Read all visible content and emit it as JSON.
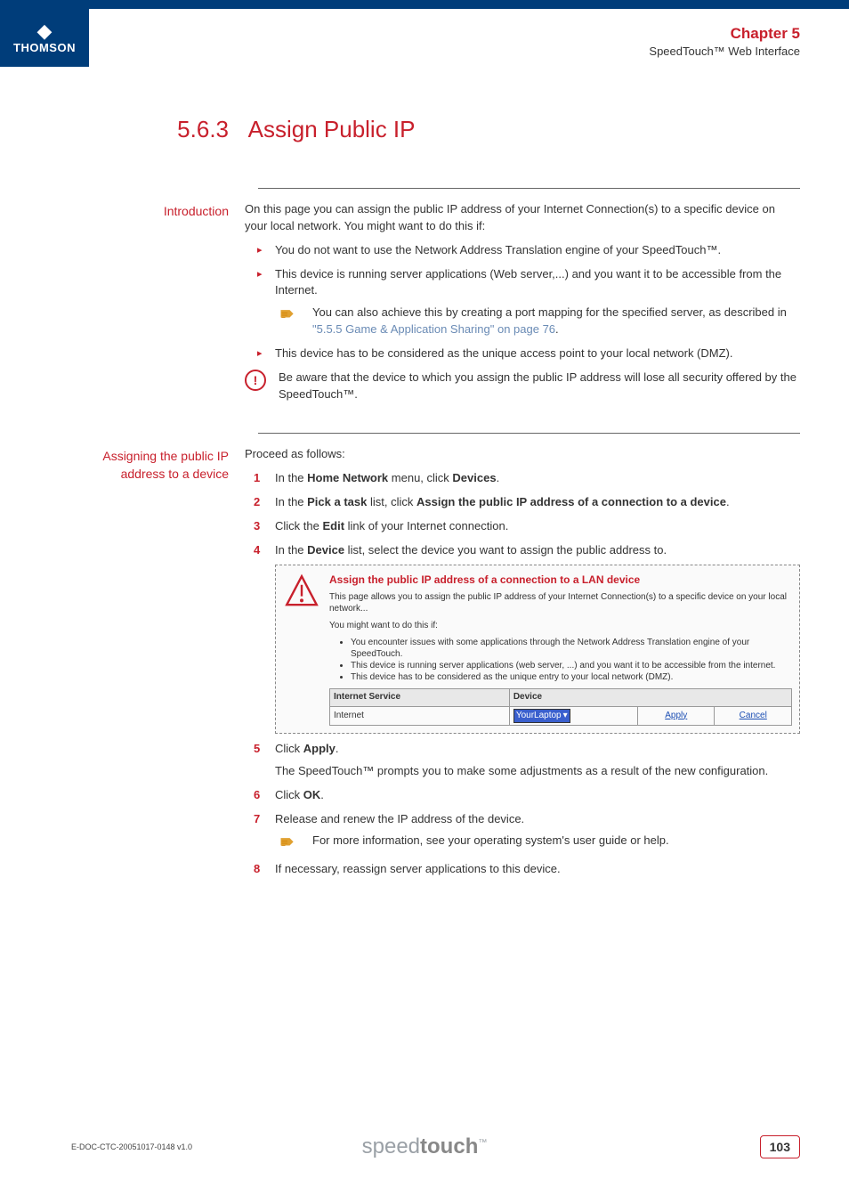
{
  "header": {
    "logo_text": "THOMSON",
    "chapter": "Chapter 5",
    "subtitle": "SpeedTouch™ Web Interface"
  },
  "section": {
    "number": "5.6.3",
    "title": "Assign Public IP"
  },
  "intro": {
    "label": "Introduction",
    "lead": "On this page you can assign the public IP address of your Internet Connection(s) to a specific device on your local network. You might want to do this if:",
    "bullets": {
      "b1": "You do not want to use the Network Address Translation engine of your SpeedTouch™.",
      "b2": "This device is running server applications (Web server,...) and you want it to be accessible from the Internet.",
      "b3": "This device has to be considered as the unique access point to your local network (DMZ)."
    },
    "tip_prefix": "You can also achieve this by creating a port mapping for the specified server, as described in ",
    "tip_xref": "\"5.5.5 Game & Application Sharing\" on page 76",
    "tip_suffix": ".",
    "warn": "Be aware that the device to which you assign the public IP address will lose all security offered by the SpeedTouch™."
  },
  "assign": {
    "label": "Assigning the public IP address to a device",
    "lead": "Proceed as follows:",
    "steps": {
      "s1_a": "In the ",
      "s1_b": "Home Network",
      "s1_c": " menu, click ",
      "s1_d": "Devices",
      "s1_e": ".",
      "s2_a": "In the ",
      "s2_b": "Pick a task",
      "s2_c": " list, click ",
      "s2_d": "Assign the public IP address of a connection to a device",
      "s2_e": ".",
      "s3_a": "Click the ",
      "s3_b": "Edit",
      "s3_c": " link of your Internet connection.",
      "s4_a": "In the ",
      "s4_b": "Device",
      "s4_c": " list, select the device you want to assign the public address to.",
      "s5_a": "Click ",
      "s5_b": "Apply",
      "s5_c": ".",
      "s5_p": "The SpeedTouch™ prompts you to make some adjustments as a result of the new configuration.",
      "s6_a": "Click ",
      "s6_b": "OK",
      "s6_c": ".",
      "s7": "Release and renew the IP address of the device.",
      "s7_tip": "For more information, see your operating system's user guide or help.",
      "s8": "If necessary, reassign server applications to this device."
    }
  },
  "screenshot": {
    "title": "Assign the public IP address of a connection to a LAN device",
    "p1": "This page allows you to assign the public IP address of your Internet Connection(s) to a specific device on your local network...",
    "p2": "You might want to do this if:",
    "li1": "You encounter issues with some applications through the Network Address Translation engine of your SpeedTouch.",
    "li2": "This device is running server applications (web server, ...) and you want it to be accessible from the internet.",
    "li3": "This device has to be considered as the unique entry to your local network (DMZ).",
    "th1": "Internet Service",
    "th2": "Device",
    "td1": "Internet",
    "select": "YourLaptop",
    "apply": "Apply",
    "cancel": "Cancel"
  },
  "footer": {
    "doc_id": "E-DOC-CTC-20051017-0148 v1.0",
    "brand_a": "speed",
    "brand_b": "touch",
    "tm": "™",
    "page": "103"
  }
}
